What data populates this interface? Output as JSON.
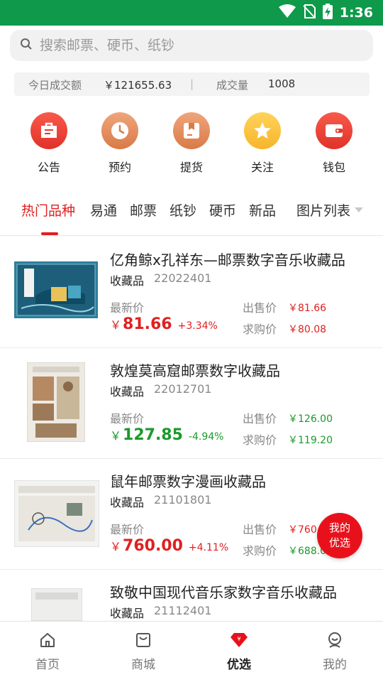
{
  "status_bar": {
    "time": "1:36"
  },
  "search": {
    "placeholder": "搜索邮票、硬币、纸钞"
  },
  "stats": {
    "turnover_label": "今日成交额",
    "turnover_value": "￥121655.63",
    "divider": "|",
    "volume_label": "成交量",
    "volume_value": "1008"
  },
  "quick_actions": [
    {
      "label": "公告",
      "icon": "announcement-icon",
      "color": "#e8372c"
    },
    {
      "label": "预约",
      "icon": "clock-icon",
      "color": "#dc8150"
    },
    {
      "label": "提货",
      "icon": "pickup-box-icon",
      "color": "#dc8150"
    },
    {
      "label": "关注",
      "icon": "star-icon",
      "color": "#f7b52a"
    },
    {
      "label": "钱包",
      "icon": "wallet-icon",
      "color": "#e8372c"
    }
  ],
  "tabs": [
    "热门品种",
    "易通",
    "邮票",
    "纸钞",
    "硬币",
    "新品"
  ],
  "view_toggle": "图片列表",
  "labels": {
    "latest": "最新价",
    "sell": "出售价",
    "buy": "求购价",
    "yen": "￥"
  },
  "products": [
    {
      "title": "亿角鲸x孔祥东—邮票数字音乐收藏品",
      "category": "收藏品",
      "code": "22022401",
      "price": "81.66",
      "change": "+3.34%",
      "sell": "￥81.66",
      "buy": "￥80.08",
      "trend": "up"
    },
    {
      "title": "敦煌莫高窟邮票数字收藏品",
      "category": "收藏品",
      "code": "22012701",
      "price": "127.85",
      "change": "-4.94%",
      "sell": "￥126.00",
      "buy": "￥119.20",
      "trend": "down"
    },
    {
      "title": "鼠年邮票数字漫画收藏品",
      "category": "收藏品",
      "code": "21101801",
      "price": "760.00",
      "change": "+4.11%",
      "sell": "￥760.0",
      "buy": "￥688.0",
      "trend": "up"
    },
    {
      "title": "致敬中国现代音乐家数字音乐收藏品",
      "category": "收藏品",
      "code": "21112401"
    }
  ],
  "floating_button": {
    "line1": "我的",
    "line2": "优选"
  },
  "bottom_nav": [
    {
      "label": "首页",
      "icon": "home-icon"
    },
    {
      "label": "商城",
      "icon": "shop-bag-icon"
    },
    {
      "label": "优选",
      "icon": "gem-yen-icon",
      "active": true
    },
    {
      "label": "我的",
      "icon": "profile-icon"
    }
  ],
  "colors": {
    "accent": "#e02020",
    "status_bar": "#0e9a4a",
    "up": "#e02020",
    "down": "#1a9a2a"
  }
}
